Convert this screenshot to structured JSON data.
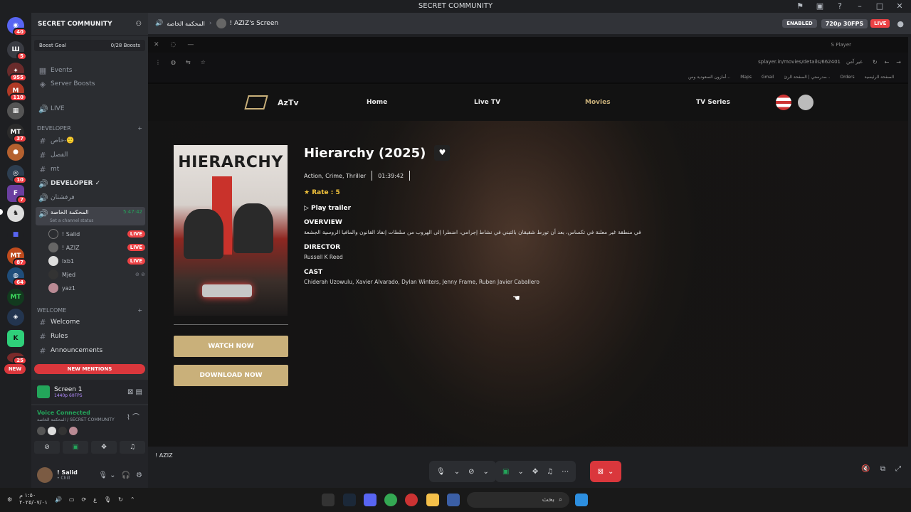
{
  "window": {
    "title": "SECRET COMMUNITY"
  },
  "server": {
    "name": "SECRET COMMUNITY",
    "boost_goal": "Boost Goal",
    "boosts": "0/28 Boosts",
    "events": "Events",
    "server_boosts": "Server Boosts",
    "live": "LIVE",
    "developer_category": "DEVELOPER",
    "channels_dev": [
      "خاص-🙂",
      "الفصل",
      "mt"
    ],
    "developer_voice": "DEVELOPER ✓",
    "voice2": "فرفشتان",
    "active_voice": "المحكمة الخاصة",
    "active_timer": "5:47:42",
    "channel_status": "Set a channel status",
    "members": [
      {
        "name": "! Salid",
        "live": "LIVE"
      },
      {
        "name": "! AZIZ",
        "live": "LIVE"
      },
      {
        "name": "lxb1",
        "live": "LIVE"
      },
      {
        "name": "Mjed",
        "live": ""
      },
      {
        "name": "yaz1",
        "live": ""
      }
    ],
    "welcome_category": "Welcome",
    "welcome_channels": [
      "Welcome",
      "Rules",
      "Announcements"
    ],
    "new_mentions": "NEW MENTIONS",
    "new_tag": "NEW"
  },
  "rail_badges": [
    "40",
    "5",
    "955",
    "110",
    "37",
    "10",
    "7",
    "87",
    "64",
    "25"
  ],
  "screen_panel": {
    "title": "Screen 1",
    "sub": "1440p 60FPS"
  },
  "voice_panel": {
    "status": "Voice Connected",
    "sub": "المحكمة الخاصة / SECRET COMMUNITY"
  },
  "user_panel": {
    "name": "! Salid",
    "status": "• Chill"
  },
  "stream_header": {
    "channel": "المحكمة الخاصة",
    "screen_name": "! AZIZ's Screen",
    "enabled": "ENABLED",
    "quality": "720p 30FPS",
    "live": "LIVE"
  },
  "browser": {
    "tab": "S Player",
    "url": "splayer.in/movies/details/662401",
    "security": "غير آمن",
    "bookmarks": [
      "الصفحة الرئيسية",
      "Orders",
      "مدرستي | الصفحة الرئ...",
      "Gmail",
      "Maps",
      "أمازون السعودية وس..."
    ]
  },
  "site": {
    "logo": "AzTv",
    "nav": [
      "Home",
      "Live TV",
      "Movies",
      "TV Series"
    ]
  },
  "movie": {
    "poster_title": "HIERARCHY",
    "title": "Hierarchy (2025)",
    "genres": "Action, Crime, Thriller",
    "duration": "01:39:42",
    "rate": "★ Rate : 5",
    "trailer": "▷ Play trailer",
    "overview_label": "OVERVIEW",
    "overview": "في منطقة غير معلنة في تكساس، بعد أن تورط شقيقان بالتبني في نشاط إجرامي، اضطرا إلى الهروب من سلطات إنفاذ القانون والمافيا الروسية الجشعة",
    "director_label": "DIRECTOR",
    "director": "Russell K Reed",
    "cast_label": "CAST",
    "cast": "Chiderah Uzowulu, Xavier Alvarado, Dylan Winters, Jenny Frame, Ruben Javier Caballero",
    "watch": "WATCH NOW",
    "download": "DOWNLOAD NOW"
  },
  "stream_bottom": {
    "label": "! AZIZ"
  },
  "taskbar": {
    "search": "بحث",
    "time": "١:٥٠ م",
    "date": "٢٠٢٥/٠٧/٠١"
  }
}
